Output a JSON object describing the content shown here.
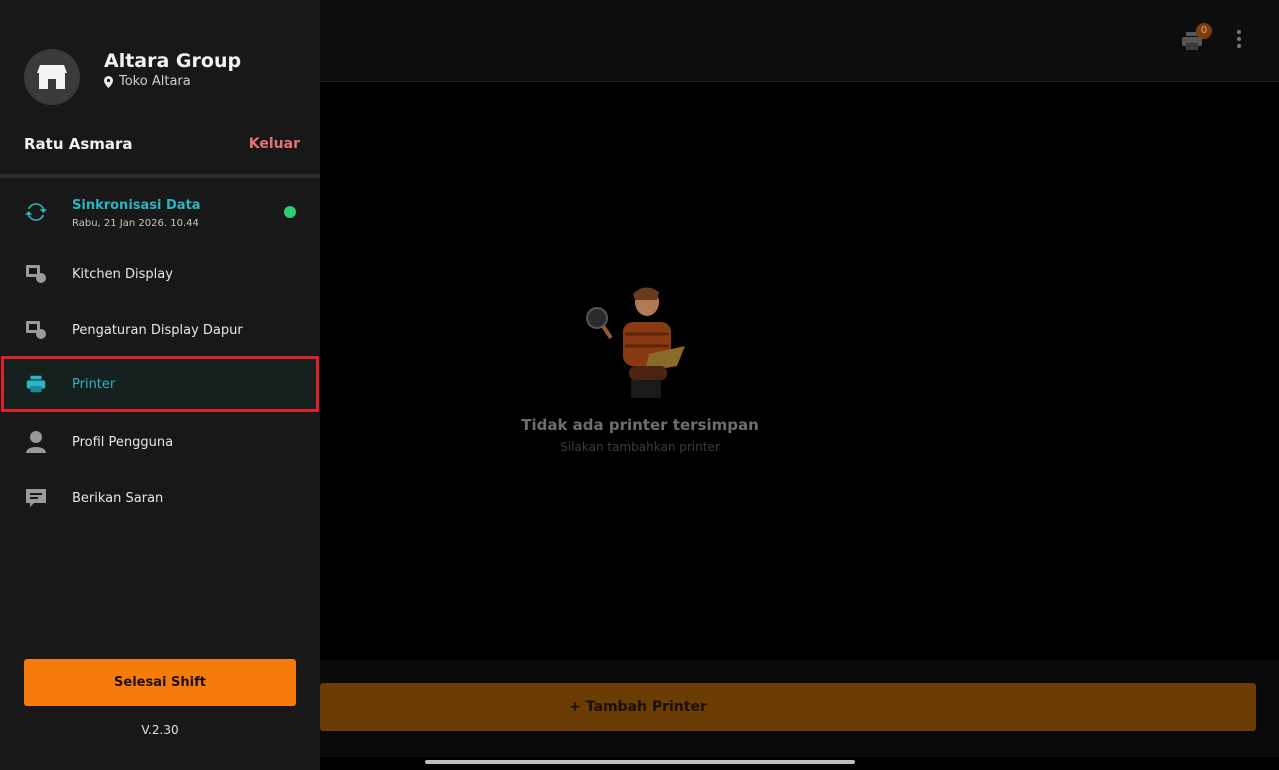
{
  "drawer": {
    "company": "Altara Group",
    "store": "Toko Altara",
    "user": "Ratu Asmara",
    "logout_label": "Keluar",
    "sync": {
      "title": "Sinkronisasi Data",
      "time": "Rabu, 21 Jan 2026. 10.44",
      "status_color": "#2ecc71"
    },
    "items": [
      {
        "label": "Kitchen Display",
        "icon": "kitchen-display-icon"
      },
      {
        "label": "Pengaturan Display Dapur",
        "icon": "kitchen-settings-icon"
      },
      {
        "label": "Printer",
        "icon": "printer-icon",
        "active": true
      },
      {
        "label": "Profil Pengguna",
        "icon": "user-icon"
      },
      {
        "label": "Berikan Saran",
        "icon": "feedback-icon"
      }
    ],
    "end_shift_label": "Selesai Shift",
    "version": "V.2.30"
  },
  "topbar": {
    "printer_badge": "0"
  },
  "empty_state": {
    "title": "Tidak ada printer tersimpan",
    "subtitle": "Silakan tambahkan printer"
  },
  "add_printer_label": "+ Tambah Printer",
  "colors": {
    "accent": "#2ab5c4",
    "primary": "#f57c0c",
    "danger": "#e57373",
    "highlight": "#d8232a"
  }
}
